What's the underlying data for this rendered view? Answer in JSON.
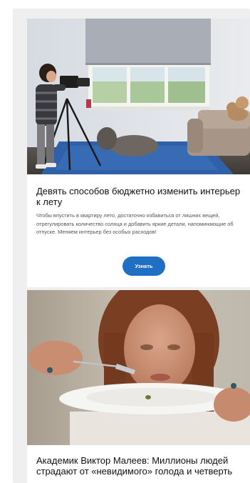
{
  "feed": {
    "cards": [
      {
        "title": "Девять способов бюджетно изменить интерьер к лету",
        "description": "Чтобы впустить в квартиру лето, достаточно избавиться от лишних вещей, отрегулировать количество солнца и добавить яркие детали, напоминающие об отпуске. Меняем интерьер без особых расходов!",
        "button_label": "Узнать"
      },
      {
        "title": "Академик Виктор Малеев: Миллионы людей страдают от «невидимого» голода и четверть"
      }
    ]
  },
  "colors": {
    "feed_background": "#efefef",
    "card_background": "#ffffff",
    "button": "#1f6fc5",
    "title_text": "#111111",
    "description_text": "#555555"
  }
}
